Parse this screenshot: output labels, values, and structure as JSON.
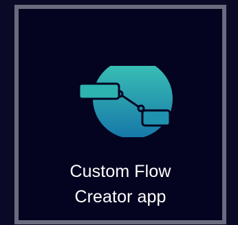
{
  "tile": {
    "label_line1": "Custom Flow",
    "label_line2": "Creator app",
    "icon": "flow-creator-icon"
  },
  "colors": {
    "background": "#0b0a26",
    "tile_background": "#040320",
    "tile_border": "#6b6b7f",
    "icon_gradient_start": "#3cc4b6",
    "icon_gradient_end": "#1677a8",
    "label_text": "#ffffff"
  }
}
